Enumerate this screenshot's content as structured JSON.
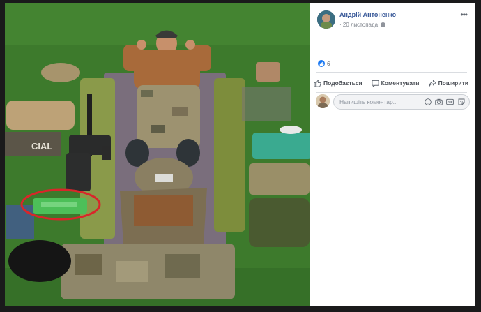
{
  "post": {
    "author_name": "Андрій Антоненко",
    "date": "20 листопада",
    "date_separator": "·",
    "more_label": "•••",
    "reactions_count": "6",
    "actions": {
      "like": "Подобається",
      "comment": "Коментувати",
      "share": "Поширити"
    },
    "comment_placeholder": "Напишіть коментар...",
    "comment_icons": [
      "emoji-icon",
      "camera-icon",
      "gif-icon",
      "sticker-icon"
    ]
  },
  "photo": {
    "patch_text": "CIAL",
    "highlight_color": "#d9262a"
  },
  "colors": {
    "author_link": "#385898",
    "like_blue": "#1877f2",
    "grass": "#3f7a2e"
  }
}
